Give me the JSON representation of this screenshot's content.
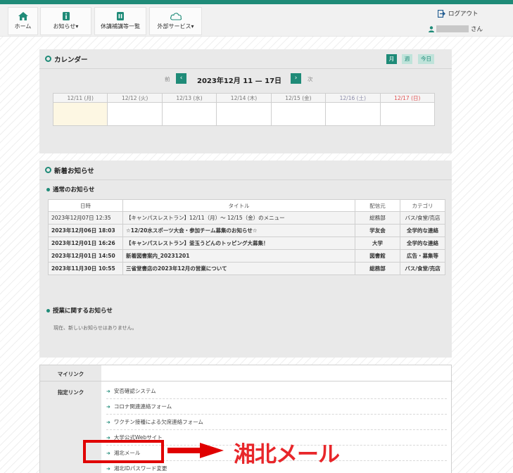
{
  "nav": {
    "home": "ホーム",
    "notices": "お知らせ▾",
    "cancellations": "休講補講等一覧",
    "external": "外部サービス▾",
    "logout": "ログアウト",
    "user_suffix": "さん"
  },
  "calendar": {
    "title": "カレンダー",
    "view_month": "月",
    "view_week": "週",
    "view_today": "今日",
    "prev_label": "前",
    "next_label": "次",
    "range": "2023年12月 11 — 17日",
    "days": [
      "12/11 (月)",
      "12/12 (火)",
      "12/13 (水)",
      "12/14 (木)",
      "12/15 (金)",
      "12/16 (土)",
      "12/17 (日)"
    ]
  },
  "news": {
    "title": "新着お知らせ",
    "general_title": "通常のお知らせ",
    "columns": [
      "日時",
      "タイトル",
      "配信元",
      "カテゴリ"
    ],
    "rows": [
      [
        "2023年12月07日 12:35",
        "【キャンパスレストラン】12/11（月）～ 12/15（金）のメニュー",
        "総務部",
        "バス/食堂/売店"
      ],
      [
        "2023年12月06日 18:03",
        "☆12/20水スポーツ大会・参加チーム募集のお知らせ☆",
        "学友会",
        "全学的な連絡"
      ],
      [
        "2023年12月01日 16:26",
        "【キャンパスレストラン】釜玉うどんのトッピング大募集！",
        "大学",
        "全学的な連絡"
      ],
      [
        "2023年12月01日 14:50",
        "新着図書案内_20231201",
        "図書館",
        "広告・募集等"
      ],
      [
        "2023年11月30日 10:55",
        "三省堂書店の2023年12月の営業について",
        "総務部",
        "バス/食堂/売店"
      ]
    ],
    "class_title": "授業に関するお知らせ",
    "class_empty": "現在、新しいお知らせはありません。"
  },
  "links": {
    "my_links": "マイリンク",
    "designated_links": "指定リンク",
    "items": [
      "安否確認システム",
      "コロナ関連連絡フォーム",
      "ワクチン接種による欠席連絡フォーム",
      "大学公式Webサイト",
      "湘北メール",
      "湘北IDパスワード変更"
    ]
  },
  "annotation": {
    "text": "湘北メール",
    "color": "#e8262a"
  },
  "colors": {
    "accent": "#1f8b78",
    "sunday": "#e05050",
    "saturday": "#8a8aa8",
    "today_cell": "#fdf7e3"
  }
}
